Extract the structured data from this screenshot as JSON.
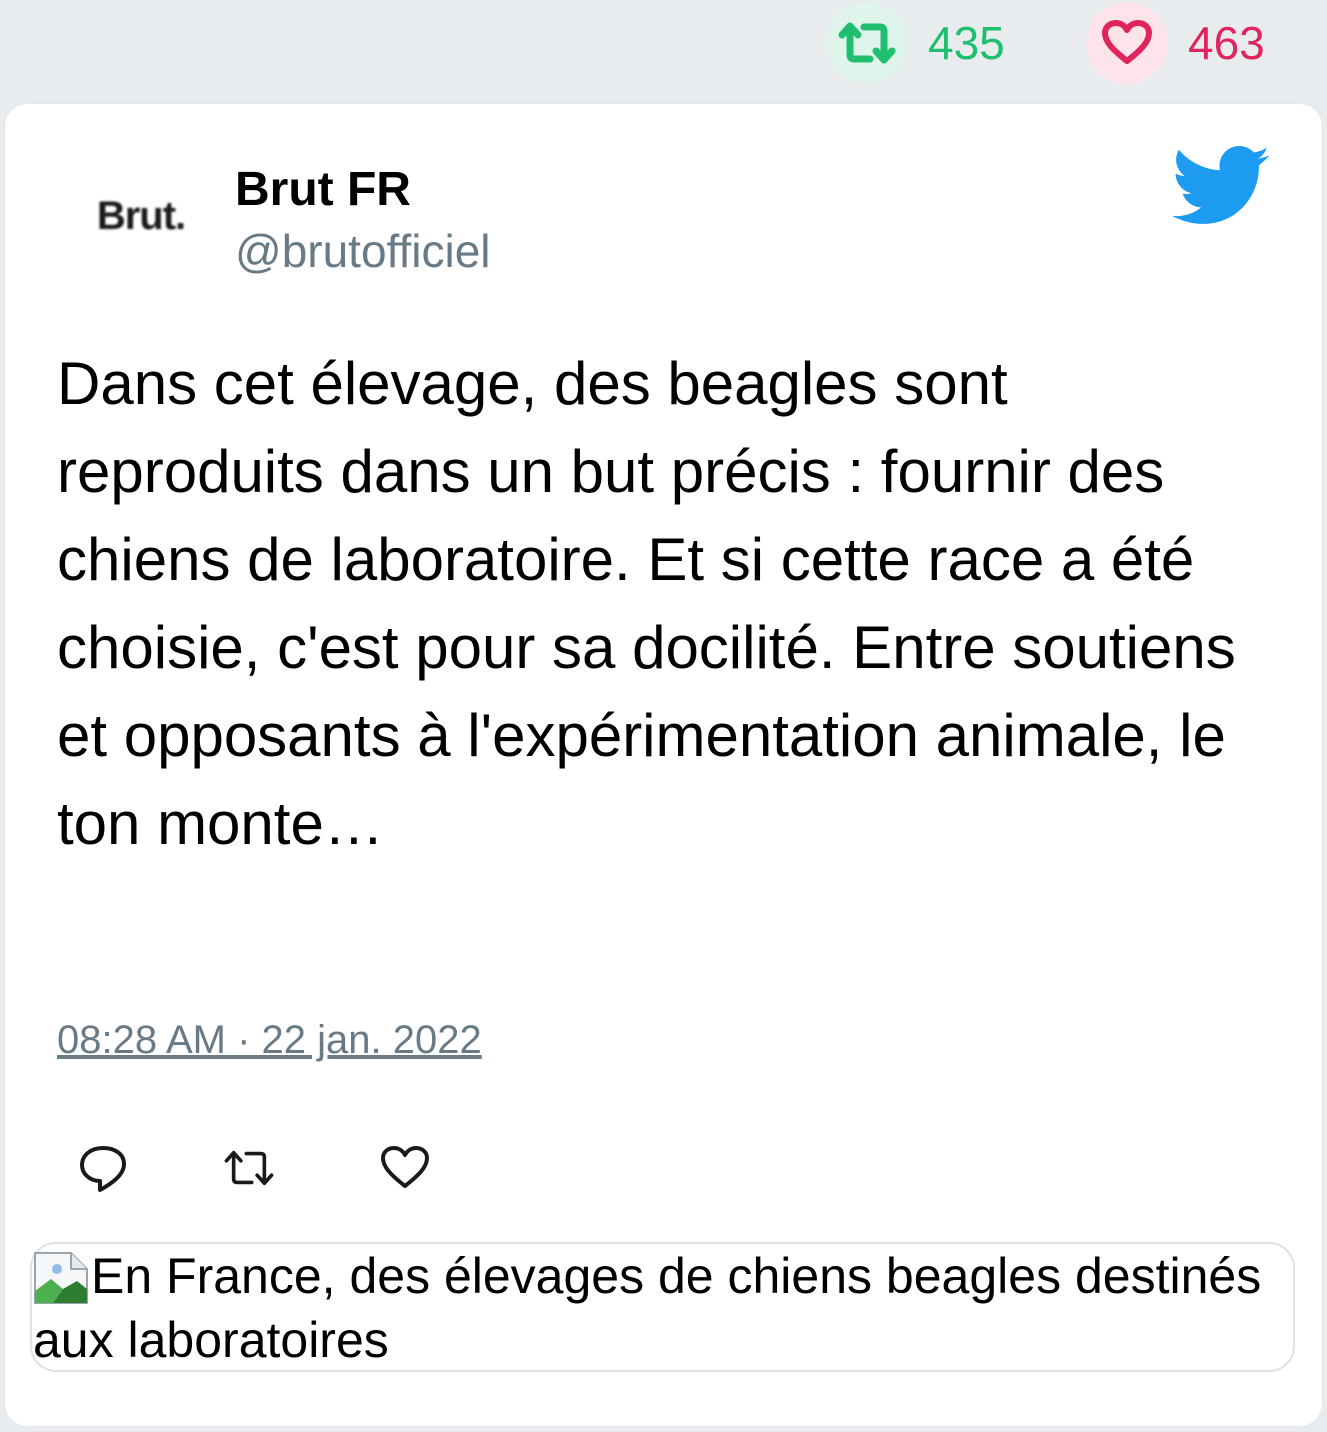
{
  "stats": {
    "retweets_count": "435",
    "likes_count": "463"
  },
  "colors": {
    "retweet": "#1fbf6f",
    "like": "#e0245e",
    "twitter_blue": "#1d9bf0",
    "muted": "#687a86"
  },
  "author": {
    "avatar_text": "Brut.",
    "display_name": "Brut FR",
    "handle": "@brutofficiel"
  },
  "tweet": {
    "text": "Dans cet élevage, des beagles sont reproduits dans un but précis : fournir des chiens de laboratoire. Et si cette race a été choisie, c'est pour sa docilité. Entre soutiens et opposants à l'expérimentation animale, le ton monte…",
    "timestamp": "08:28 AM · 22 jan. 2022"
  },
  "icons": [
    "retweet-icon",
    "heart-icon",
    "twitter-bird-icon",
    "reply-icon",
    "broken-image-icon"
  ],
  "link_preview": {
    "alt_text": "En France, des élevages de chiens beagles destinés aux laboratoires"
  }
}
